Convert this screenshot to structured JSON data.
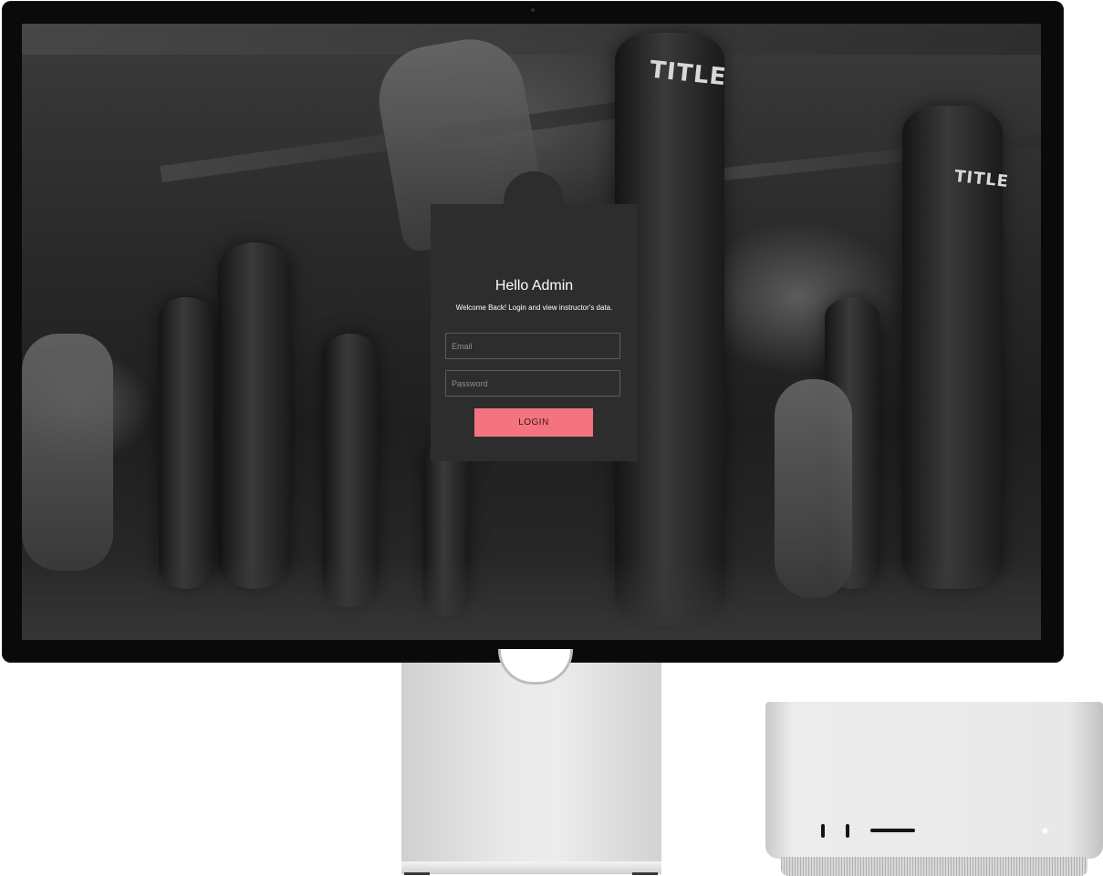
{
  "login": {
    "title": "Hello Admin",
    "subtitle": "Welcome Back! Login and view instructor's data.",
    "email_placeholder": "Email",
    "email_value": "",
    "password_placeholder": "Password",
    "password_value": "",
    "button_label": "LOGIN"
  },
  "background": {
    "bag_labels": [
      "TITLE",
      "TITLE"
    ]
  },
  "colors": {
    "card": "#2d2d2d",
    "accent": "#f3747f",
    "bezel": "#0a0a0a"
  },
  "icons": {
    "power": "power-led-icon",
    "ports": "usb-port-icon"
  }
}
